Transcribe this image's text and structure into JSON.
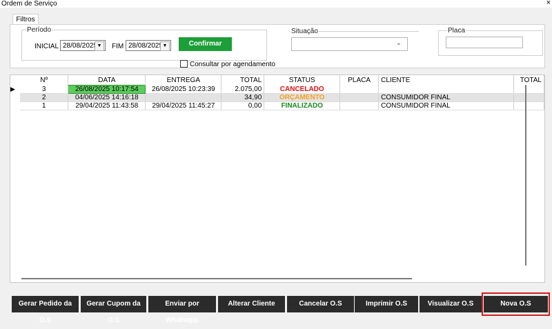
{
  "window": {
    "title": "Ordem de Serviço",
    "close_symbol": "×"
  },
  "tab": {
    "label": "Filtros"
  },
  "filters": {
    "periodo_label": "Período",
    "inicial_label": "INICIAL",
    "inicial_value": "28/08/2025",
    "fim_label": "FIM",
    "fim_value": "28/08/2025",
    "confirm_label": "Confirmar",
    "situacao_label": "Situação",
    "situacao_value": "",
    "placa_label": "Placa",
    "placa_value": "",
    "agendamento_label": "Consultar por agendamento"
  },
  "grid": {
    "columns": [
      "Nº",
      "DATA",
      "ENTREGA",
      "TOTAL",
      "STATUS",
      "PLACA",
      "CLIENTE",
      "TOTAL"
    ],
    "rows": [
      {
        "num": "3",
        "data": "26/08/2025 10:17:54",
        "entrega": "26/08/2025 10:23:39",
        "total": "2.075,00",
        "status": "CANCELADO",
        "status_color": "#e01010",
        "placa": "",
        "cliente": "",
        "total2": ""
      },
      {
        "num": "2",
        "data": "04/06/2025 14:16:18",
        "entrega": "",
        "total": "34,90",
        "status": "ORÇAMENTO",
        "status_color": "#f0a020",
        "placa": "",
        "cliente": "CONSUMIDOR FINAL",
        "total2": ""
      },
      {
        "num": "1",
        "data": "29/04/2025 11:43:58",
        "entrega": "29/04/2025 11:45:27",
        "total": "0,00",
        "status": "FINALIZADO",
        "status_color": "#1a8a1a",
        "placa": "",
        "cliente": "CONSUMIDOR FINAL",
        "total2": ""
      }
    ],
    "selected_cell_color": "#5ccd5c"
  },
  "buttons": {
    "gerar_pedido": "Gerar Pedido da O.S",
    "gerar_cupom": "Gerar Cupom da O.S",
    "enviar_whatsapp": "Enviar por Whatsapp",
    "alterar_cliente": "Alterar Cliente",
    "cancelar": "Cancelar O.S",
    "imprimir": "Imprimir O.S",
    "visualizar": "Visualizar O.S",
    "nova": "Nova O.S"
  },
  "icons": {
    "dropdown": "chevron-down-icon",
    "row_marker": "triangle-right-icon"
  }
}
